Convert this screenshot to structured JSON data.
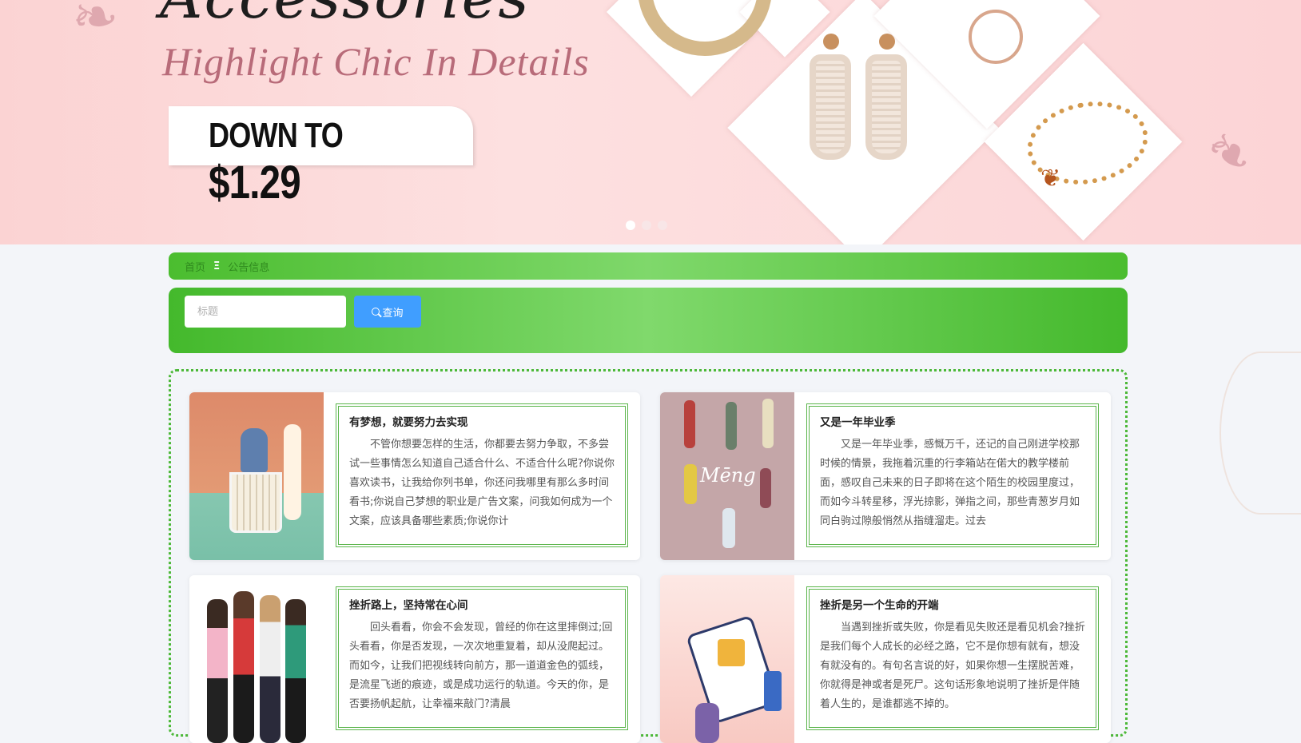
{
  "banner": {
    "script_title": "Accessories",
    "tagline": "Highlight Chic In Details",
    "down_to": "DOWN TO",
    "price": "$1.29",
    "slides": [
      true,
      false,
      false
    ]
  },
  "breadcrumb": {
    "home": "首页",
    "separator": "Ξ",
    "current": "公告信息"
  },
  "search": {
    "placeholder": "标题",
    "button_label": "查询"
  },
  "notices": [
    {
      "title": "有梦想，就要努力去实现",
      "body": "不管你想要怎样的生活，你都要去努力争取，不多尝试一些事情怎么知道自己适合什么、不适合什么呢?你说你喜欢读书，让我给你列书单，你还问我哪里有那么多时间看书;你说自己梦想的职业是广告文案，问我如何成为一个文案，应该具备哪些素质;你说你计"
    },
    {
      "title": "又是一年毕业季",
      "body": "又是一年毕业季，感慨万千，还记的自己刚进学校那时候的情景，我拖着沉重的行李箱站在偌大的教学楼前面，感叹自己未来的日子即将在这个陌生的校园里度过，而如今斗转星移，浮光掠影，弹指之间，那些青葱岁月如同白驹过隙般悄然从指缝溜走。过去"
    },
    {
      "title": "挫折路上，坚持常在心间",
      "body": "回头看看，你会不会发现，曾经的你在这里摔倒过;回头看看，你是否发现，一次次地重复着，却从没爬起过。而如今，让我们把视线转向前方，那一道道金色的弧线，是流星飞逝的痕迹，或是成功运行的轨道。今天的你，是否要扬帆起航，让幸福来敲门?清晨"
    },
    {
      "title": "挫折是另一个生命的开端",
      "body": "当遇到挫折或失败，你是看见失败还是看见机会?挫折是我们每个人成长的必经之路，它不是你想有就有，想没有就没有的。有句名言说的好，如果你想一生摆脱苦难，你就得是神或者是死尸。这句话形象地说明了挫折是伴随着人生的，是谁都逃不掉的。"
    }
  ],
  "colors": {
    "green": "#4bbd2f",
    "button": "#409eff",
    "banner_pink": "#fbd3d3"
  }
}
